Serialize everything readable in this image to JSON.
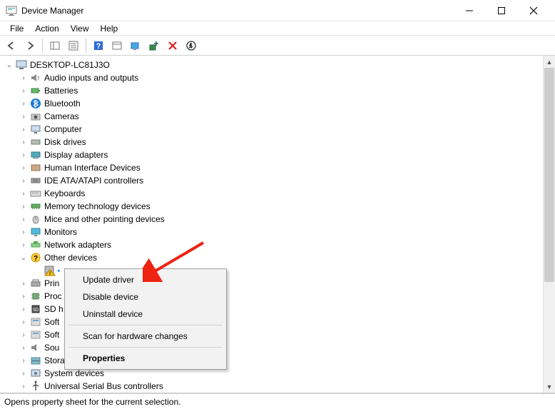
{
  "window": {
    "title": "Device Manager"
  },
  "menubar": {
    "file": "File",
    "action": "Action",
    "view": "View",
    "help": "Help"
  },
  "root": {
    "label": "DESKTOP-LC81J3O"
  },
  "categories": {
    "c0": "Audio inputs and outputs",
    "c1": "Batteries",
    "c2": "Bluetooth",
    "c3": "Cameras",
    "c4": "Computer",
    "c5": "Disk drives",
    "c6": "Display adapters",
    "c7": "Human Interface Devices",
    "c8": "IDE ATA/ATAPI controllers",
    "c9": "Keyboards",
    "c10": "Memory technology devices",
    "c11": "Mice and other pointing devices",
    "c12": "Monitors",
    "c13": "Network adapters",
    "c14": "Other devices",
    "c15": "Prin",
    "c16": "Proc",
    "c17": "SD h",
    "c18": "Soft",
    "c19": "Soft",
    "c20": "Sou",
    "c21": "Storage controllers",
    "c22": "System devices",
    "c23": "Universal Serial Bus controllers"
  },
  "context_menu": {
    "update_driver": "Update driver",
    "disable_device": "Disable device",
    "uninstall_device": "Uninstall device",
    "scan": "Scan for hardware changes",
    "properties": "Properties"
  },
  "statusbar": {
    "text": "Opens property sheet for the current selection."
  }
}
